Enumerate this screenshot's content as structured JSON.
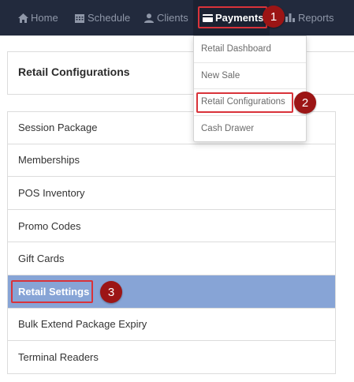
{
  "navbar": {
    "items": [
      {
        "label": "Home",
        "icon": "home-icon"
      },
      {
        "label": "Schedule",
        "icon": "calendar-icon"
      },
      {
        "label": "Clients",
        "icon": "user-icon"
      },
      {
        "label": "Payments",
        "icon": "credit-card-icon"
      },
      {
        "label": "Reports",
        "icon": "bar-chart-icon"
      }
    ]
  },
  "dropdown": {
    "items": [
      "Retail Dashboard",
      "New Sale",
      "Retail Configurations",
      "Cash Drawer"
    ]
  },
  "header": {
    "title": "Retail Configurations"
  },
  "list": {
    "items": [
      "Session Package",
      "Memberships",
      "POS Inventory",
      "Promo Codes",
      "Gift Cards",
      "Retail Settings",
      "Bulk Extend Package Expiry",
      "Terminal Readers"
    ],
    "active": "Retail Settings"
  },
  "callouts": [
    "1",
    "2",
    "3"
  ],
  "colors": {
    "navbar": "#222a3d",
    "active_row": "#87a4d6",
    "callout": "#9c1515",
    "highlight": "#d9333a"
  }
}
